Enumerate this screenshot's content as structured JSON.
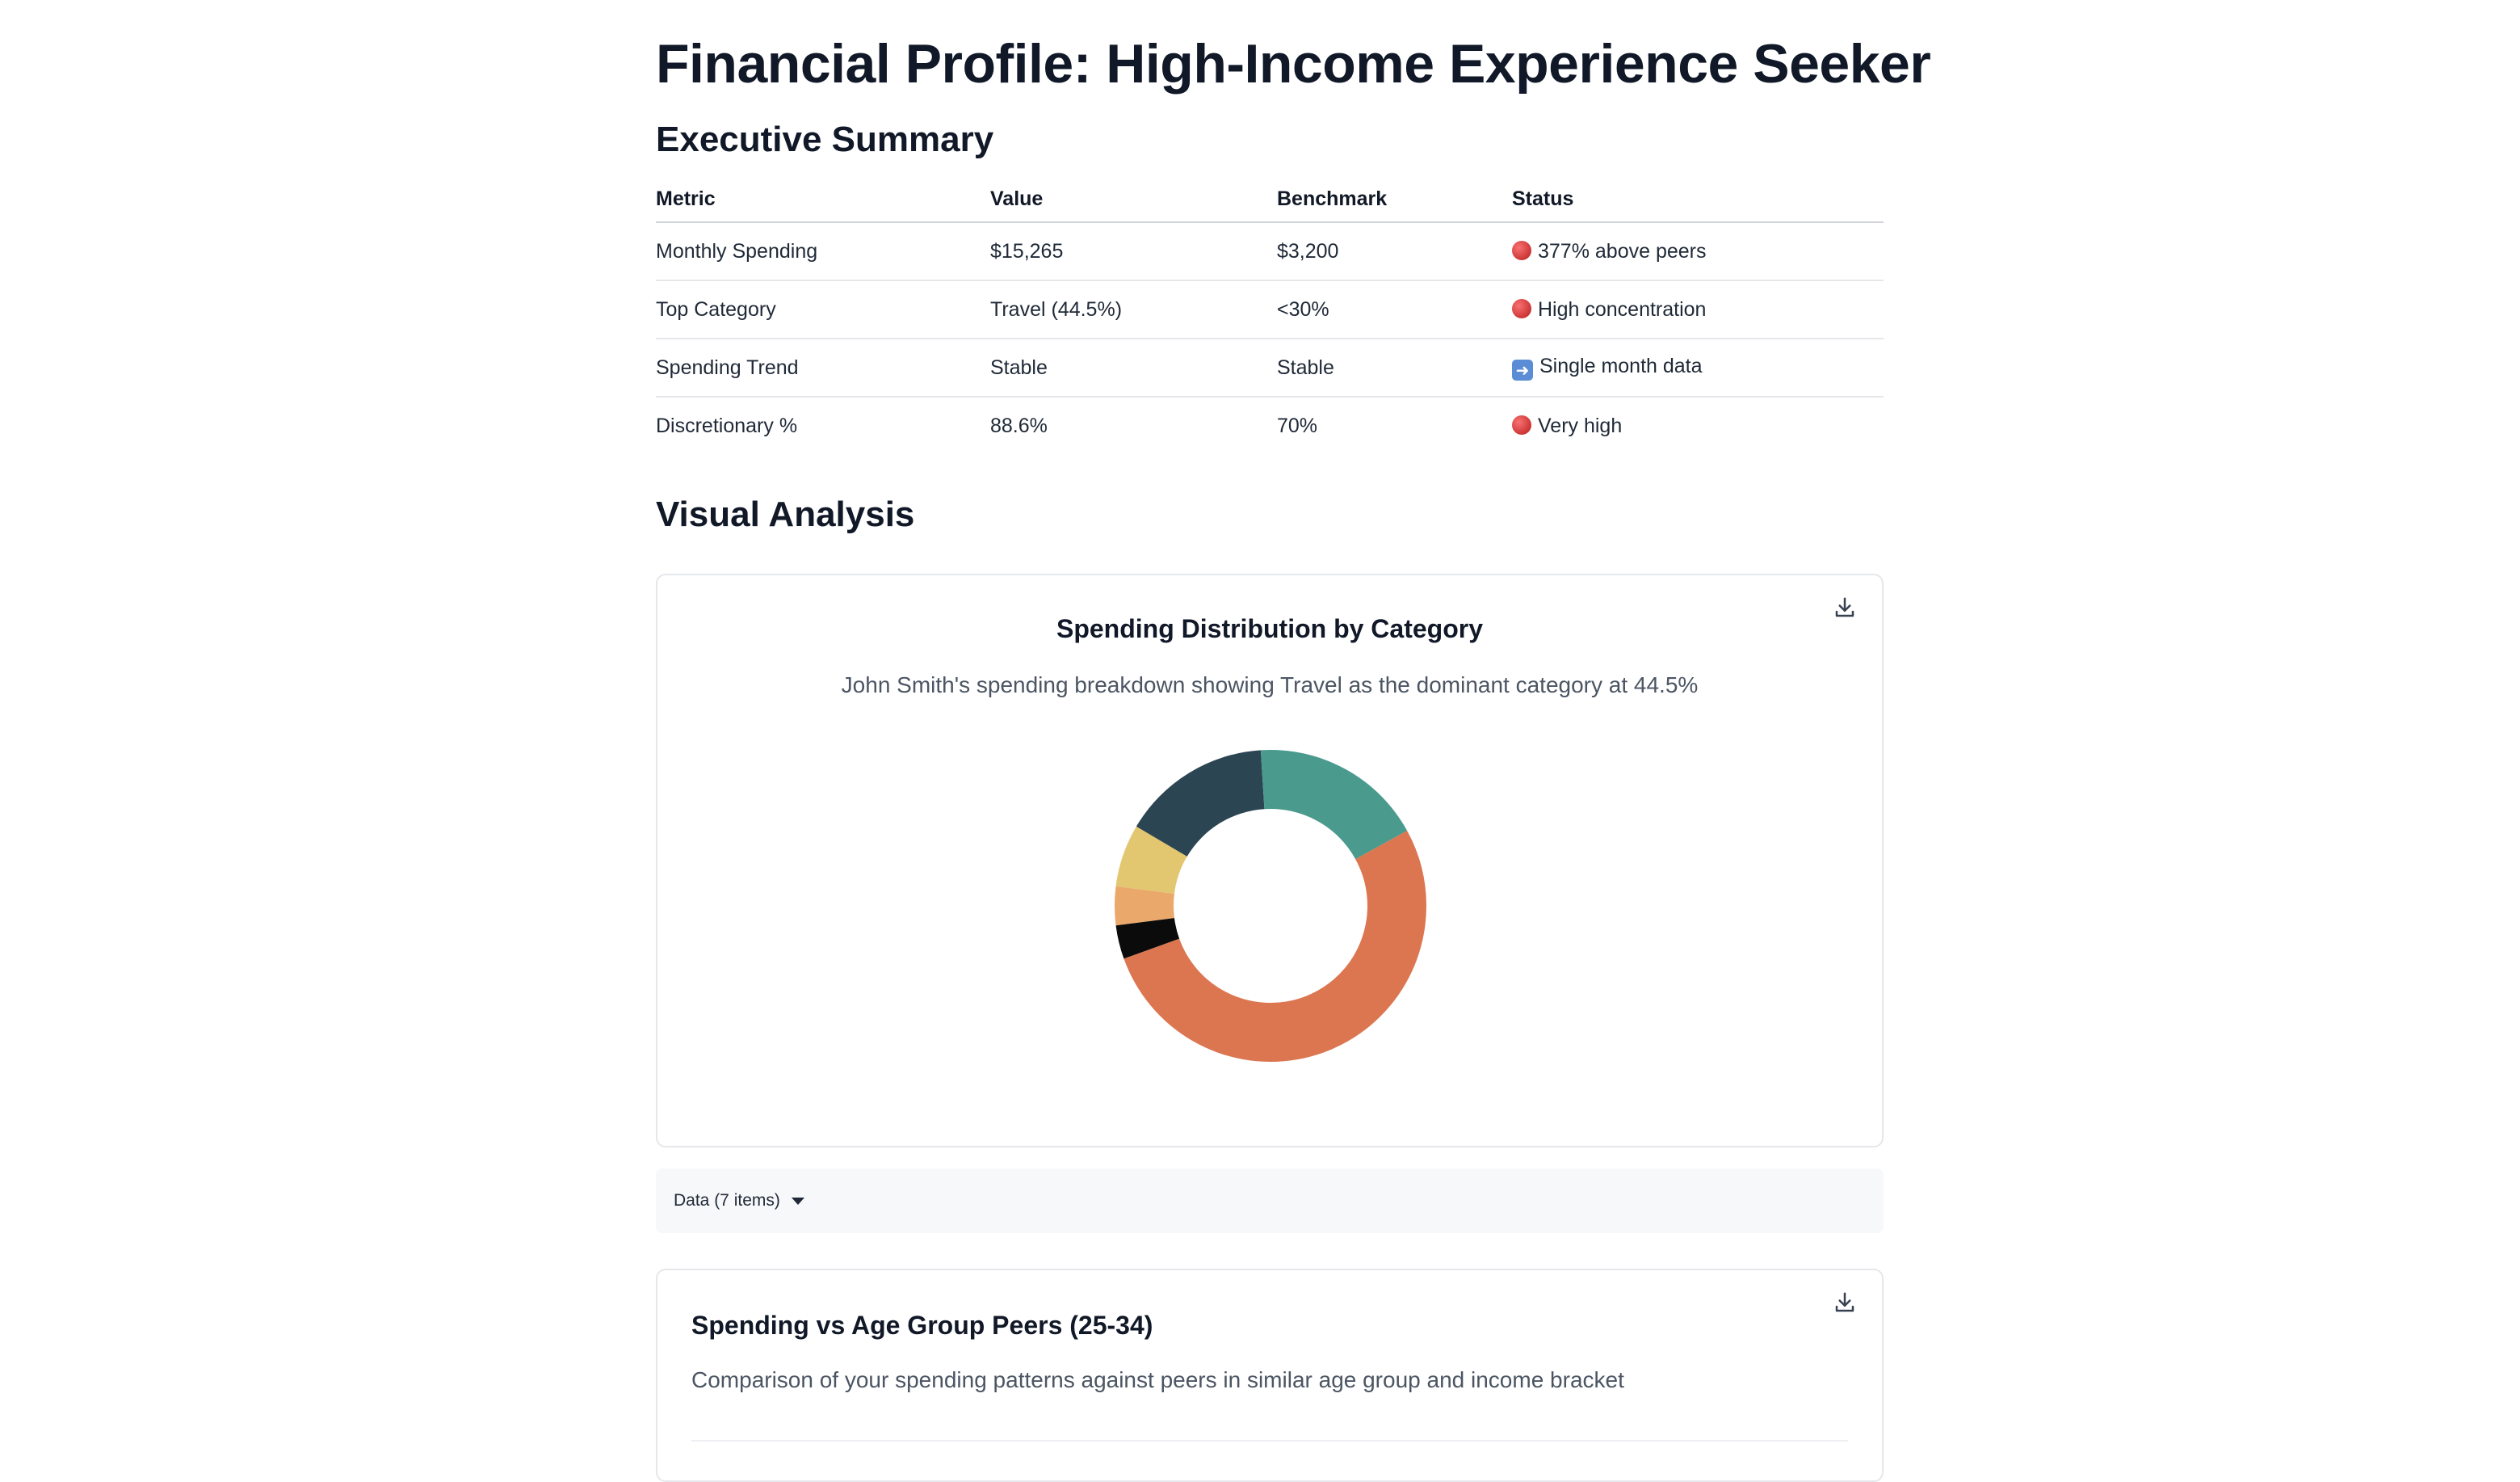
{
  "page": {
    "title": "Financial Profile: High-Income Experience Seeker"
  },
  "summary": {
    "heading": "Executive Summary",
    "columns": [
      "Metric",
      "Value",
      "Benchmark",
      "Status"
    ],
    "rows": [
      {
        "metric": "Monthly Spending",
        "value": "$15,265",
        "benchmark": "$3,200",
        "status_icon": "red-circle-icon",
        "status": "377% above peers"
      },
      {
        "metric": "Top Category",
        "value": "Travel (44.5%)",
        "benchmark": "<30%",
        "status_icon": "red-circle-icon",
        "status": "High concentration"
      },
      {
        "metric": "Spending Trend",
        "value": "Stable",
        "benchmark": "Stable",
        "status_icon": "right-arrow-icon",
        "status": "Single month data"
      },
      {
        "metric": "Discretionary %",
        "value": "88.6%",
        "benchmark": "70%",
        "status_icon": "red-circle-icon",
        "status": "Very high"
      }
    ]
  },
  "visual": {
    "heading": "Visual Analysis",
    "card1": {
      "title": "Spending Distribution by Category",
      "description": "John Smith's spending breakdown showing Travel as the dominant category at 44.5%",
      "download_icon": "download-icon"
    },
    "data_toggle": {
      "label": "Data (7 items)",
      "icon": "caret-down-icon"
    },
    "card2": {
      "title": "Spending vs Age Group Peers (25-34)",
      "description": "Comparison of your spending patterns against peers in similar age group and income bracket",
      "download_icon": "download-icon"
    }
  },
  "chart_data": {
    "type": "pie",
    "variant": "donut",
    "values": [
      44.5,
      3.5,
      4.0,
      6.5,
      15.5,
      18.0,
      8.0
    ],
    "colors": [
      "#DC7651",
      "#0B0B0B",
      "#EAA86A",
      "#E3C770",
      "#2C4553",
      "#4A9A8E",
      "#DC7651"
    ],
    "start": "3 o'clock, clockwise",
    "legend": "none"
  }
}
